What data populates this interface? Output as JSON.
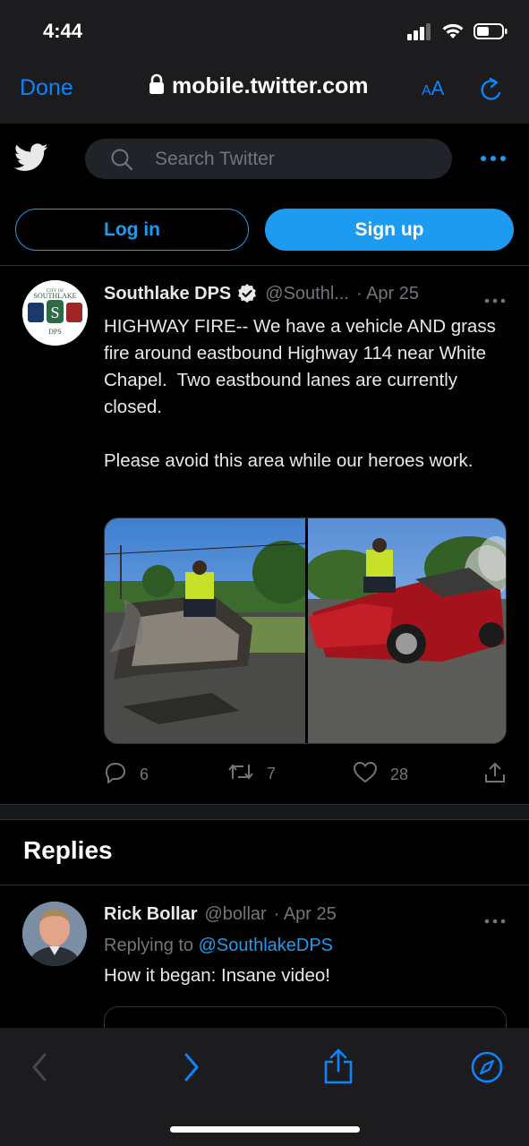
{
  "status_bar": {
    "time": "4:44"
  },
  "browser": {
    "done_label": "Done",
    "url": "mobile.twitter.com",
    "text_size_label_small": "A",
    "text_size_label_large": "A"
  },
  "twitter_header": {
    "search_placeholder": "Search Twitter"
  },
  "auth": {
    "login_label": "Log in",
    "signup_label": "Sign up"
  },
  "tweet": {
    "name": "Southlake DPS",
    "handle": "@Southl...",
    "date": "· Apr 25",
    "text": "HIGHWAY FIRE-- We have a vehicle AND grass fire around eastbound Highway 114 near White Chapel.  Two eastbound lanes are currently closed.\n\nPlease avoid this area while our heroes work.",
    "avatar_text_top": "CITY OF",
    "avatar_text_main": "SOUTHLAKE",
    "avatar_text_bottom": "DPS",
    "reply_count": "6",
    "retweet_count": "7",
    "like_count": "28"
  },
  "replies": {
    "title": "Replies",
    "items": [
      {
        "name": "Rick Bollar",
        "handle": "@bollar",
        "date": "· Apr 25",
        "replying_prefix": "Replying to ",
        "replying_to": "@SouthlakeDPS",
        "text": "How it began: Insane video!"
      }
    ]
  },
  "colors": {
    "accent": "#1d9bf0",
    "safari_blue": "#0a84ff",
    "muted_text": "#71767b",
    "bar_bg": "#1c1c1e"
  }
}
